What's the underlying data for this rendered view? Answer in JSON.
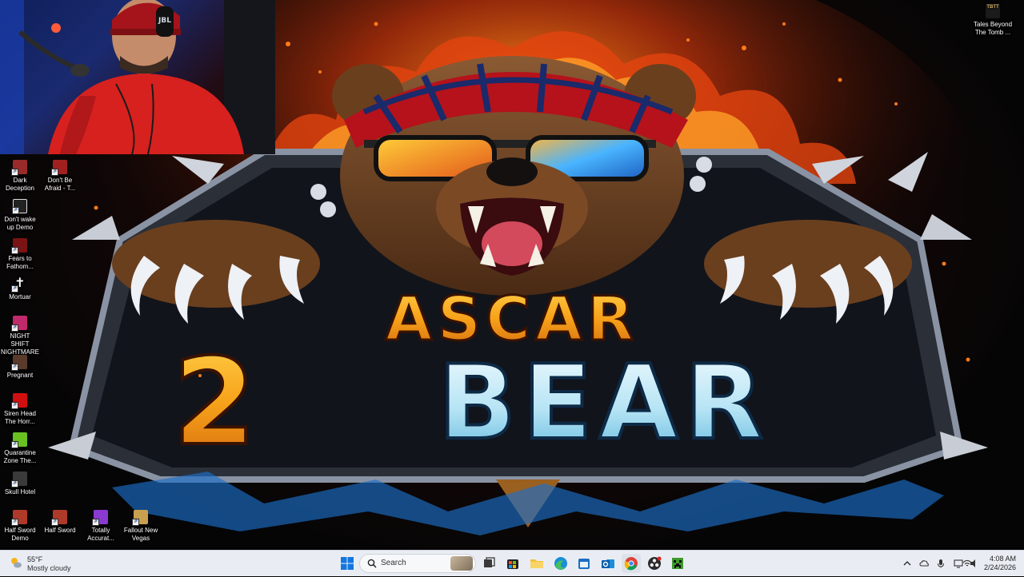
{
  "desktop": {
    "wallpaper": {
      "line1": "ASCAR",
      "line2_num": "2",
      "line2_word": "BEAR"
    },
    "icons_left": [
      {
        "label": "Dark Deception",
        "icon": "game-icon",
        "color": "#9a2a2a"
      },
      {
        "label": "Don't Be Afraid - T...",
        "icon": "game-icon",
        "color": "#a32020"
      },
      {
        "label": "Don't wake up Demo",
        "icon": "game-icon",
        "color": "#dddddd"
      },
      {
        "label": "Fears to Fathom...",
        "icon": "game-icon",
        "color": "#7a1414"
      },
      {
        "label": "Mortuar",
        "icon": "cross-icon",
        "color": "#ffffff"
      },
      {
        "label": "NIGHT SHIFT NIGHTMARE",
        "icon": "game-icon",
        "color": "#c02a6a"
      },
      {
        "label": "Pregnant",
        "icon": "game-icon",
        "color": "#5a3a2a"
      },
      {
        "label": "Siren Head The Horr...",
        "icon": "game-icon",
        "color": "#d01010"
      },
      {
        "label": "Quarantine Zone The...",
        "icon": "game-icon",
        "color": "#6ac020"
      },
      {
        "label": "Skull Hotel",
        "icon": "game-icon",
        "color": "#cccccc"
      }
    ],
    "icons_bottom": [
      {
        "label": "Half Sword Demo",
        "icon": "game-icon",
        "color": "#b03a2a"
      },
      {
        "label": "Half Sword",
        "icon": "game-icon",
        "color": "#b03a2a"
      },
      {
        "label": "Totally Accurat...",
        "icon": "game-icon",
        "color": "#8a3ad0"
      },
      {
        "label": "Fallout New Vegas",
        "icon": "game-icon",
        "color": "#c8a050"
      }
    ],
    "icon_top_right": {
      "label": "Tales Beyond The Tomb ...",
      "badge": "TBTT",
      "icon": "game-icon"
    }
  },
  "taskbar": {
    "weather": {
      "temp": "55°F",
      "condition": "Mostly cloudy",
      "icon": "sun-cloud-icon"
    },
    "search_placeholder": "Search",
    "apps": [
      {
        "name": "start-button",
        "icon": "windows-icon"
      },
      {
        "name": "task-view-button",
        "icon": "task-view-icon"
      },
      {
        "name": "taskbar-app-store",
        "icon": "store-icon"
      },
      {
        "name": "taskbar-app-explorer",
        "icon": "folder-icon"
      },
      {
        "name": "taskbar-app-edge",
        "icon": "edge-icon"
      },
      {
        "name": "taskbar-app-calendar",
        "icon": "calendar-icon"
      },
      {
        "name": "taskbar-app-outlook",
        "icon": "outlook-icon"
      },
      {
        "name": "taskbar-app-chrome",
        "icon": "chrome-icon"
      },
      {
        "name": "taskbar-app-obs",
        "icon": "obs-icon"
      },
      {
        "name": "taskbar-app-minecraft",
        "icon": "minecraft-icon"
      }
    ],
    "tray": {
      "icons": [
        "chevron-up-icon",
        "cloud-icon",
        "microphone-icon",
        "display-icon",
        "wifi-icon",
        "speaker-icon",
        "battery-icon"
      ],
      "time": "4:08 AM",
      "date": "2/24/2026"
    }
  }
}
